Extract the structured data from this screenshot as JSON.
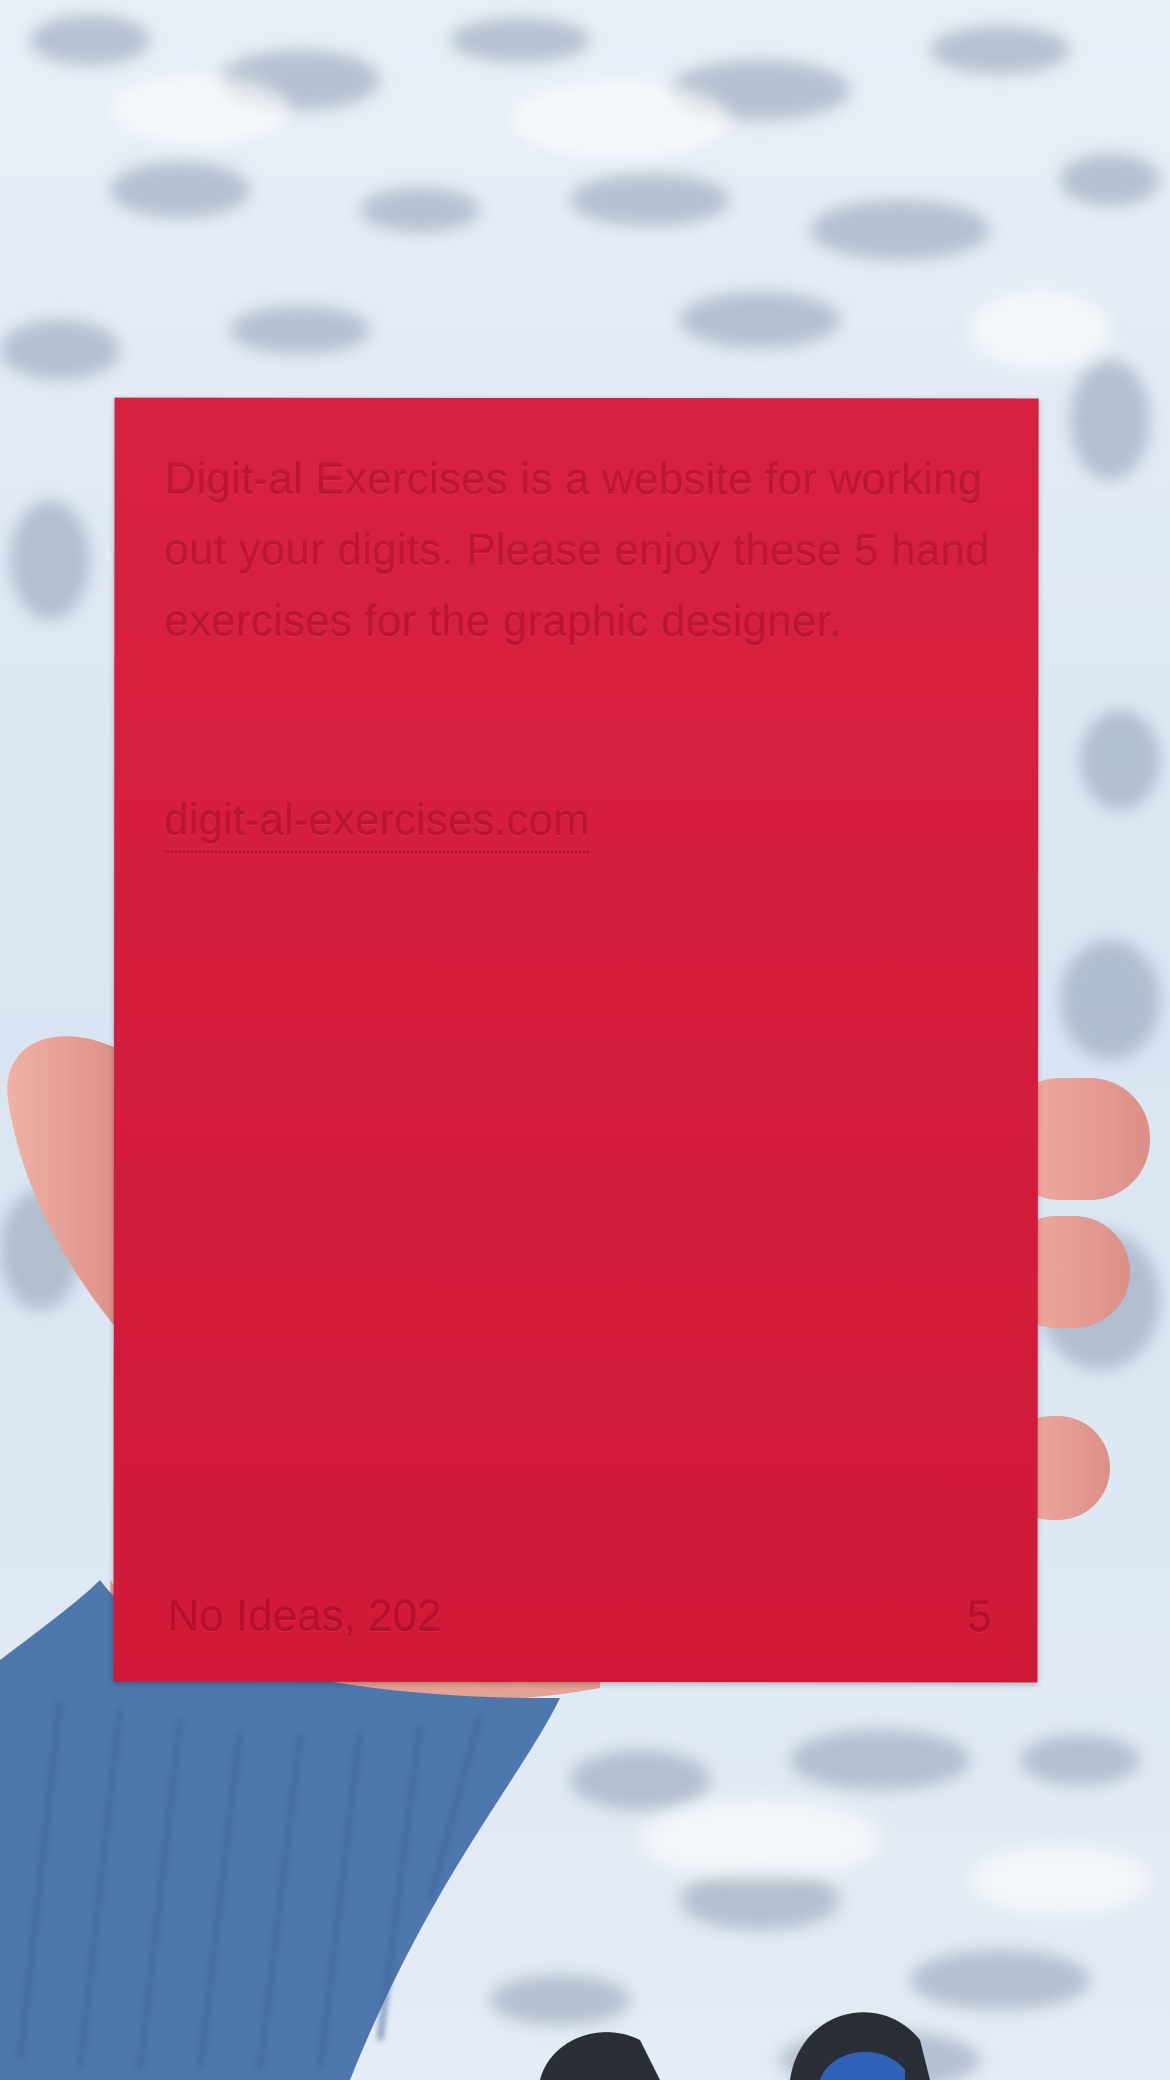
{
  "card": {
    "color": "#d61a3a",
    "text_color": "#bb0f2e",
    "description": "Digit-al Exercises is a website for working out your digits. Please enjoy these 5 hand exercises for the graphic designer.",
    "url": "digit-al-exercises.com",
    "footer_left": "No Ideas, 202",
    "footer_right": "5"
  },
  "scene": {
    "background_color": "#dfe9f3",
    "sweater_color": "#4e77ad",
    "skin_color": "#e9a49a"
  }
}
